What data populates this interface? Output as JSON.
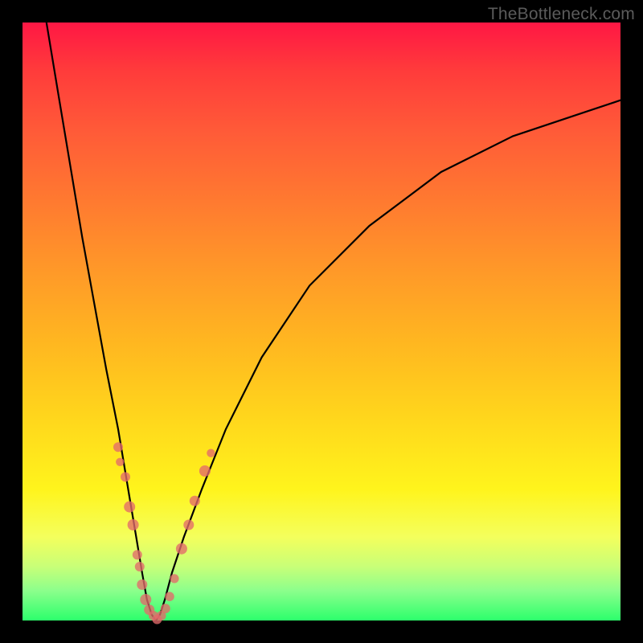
{
  "watermark": "TheBottleneck.com",
  "colors": {
    "frame_bg_top": "#ff1744",
    "frame_bg_bottom": "#2cff6c",
    "curve_stroke": "#000000",
    "marker_fill": "#e36a6a",
    "page_bg": "#000000",
    "watermark_text": "#5b5b5b"
  },
  "chart_data": {
    "type": "line",
    "title": "",
    "xlabel": "",
    "ylabel": "",
    "xlim": [
      0,
      100
    ],
    "ylim": [
      0,
      100
    ],
    "grid": false,
    "legend": false,
    "series": [
      {
        "name": "bottleneck-curve",
        "x": [
          4,
          6,
          8,
          10,
          12,
          14,
          16,
          18,
          19,
          20,
          20.8,
          21.6,
          22.3,
          23,
          23.8,
          25,
          27,
          30,
          34,
          40,
          48,
          58,
          70,
          82,
          94,
          100
        ],
        "y": [
          100,
          88,
          76,
          64,
          53,
          42,
          32,
          20,
          14,
          8,
          3.5,
          1,
          0,
          1,
          3.5,
          8,
          14,
          22,
          32,
          44,
          56,
          66,
          75,
          81,
          85,
          87
        ]
      }
    ],
    "markers": [
      {
        "x": 16.0,
        "y": 29.0,
        "r": 6
      },
      {
        "x": 16.3,
        "y": 26.5,
        "r": 5.2
      },
      {
        "x": 17.2,
        "y": 24.0,
        "r": 6
      },
      {
        "x": 17.9,
        "y": 19.0,
        "r": 7
      },
      {
        "x": 18.5,
        "y": 16.0,
        "r": 7
      },
      {
        "x": 19.2,
        "y": 11.0,
        "r": 6
      },
      {
        "x": 19.6,
        "y": 9.0,
        "r": 6
      },
      {
        "x": 20.0,
        "y": 6.0,
        "r": 6.5
      },
      {
        "x": 20.6,
        "y": 3.5,
        "r": 7
      },
      {
        "x": 21.2,
        "y": 1.8,
        "r": 6.5
      },
      {
        "x": 21.9,
        "y": 0.8,
        "r": 6
      },
      {
        "x": 22.5,
        "y": 0.2,
        "r": 6
      },
      {
        "x": 23.2,
        "y": 0.8,
        "r": 6
      },
      {
        "x": 23.9,
        "y": 2.0,
        "r": 6
      },
      {
        "x": 24.6,
        "y": 4.0,
        "r": 5.8
      },
      {
        "x": 25.4,
        "y": 7.0,
        "r": 5.6
      },
      {
        "x": 26.6,
        "y": 12.0,
        "r": 7
      },
      {
        "x": 27.8,
        "y": 16.0,
        "r": 6.5
      },
      {
        "x": 28.8,
        "y": 20.0,
        "r": 6.5
      },
      {
        "x": 30.5,
        "y": 25.0,
        "r": 7
      },
      {
        "x": 31.5,
        "y": 28.0,
        "r": 5.2
      }
    ]
  }
}
